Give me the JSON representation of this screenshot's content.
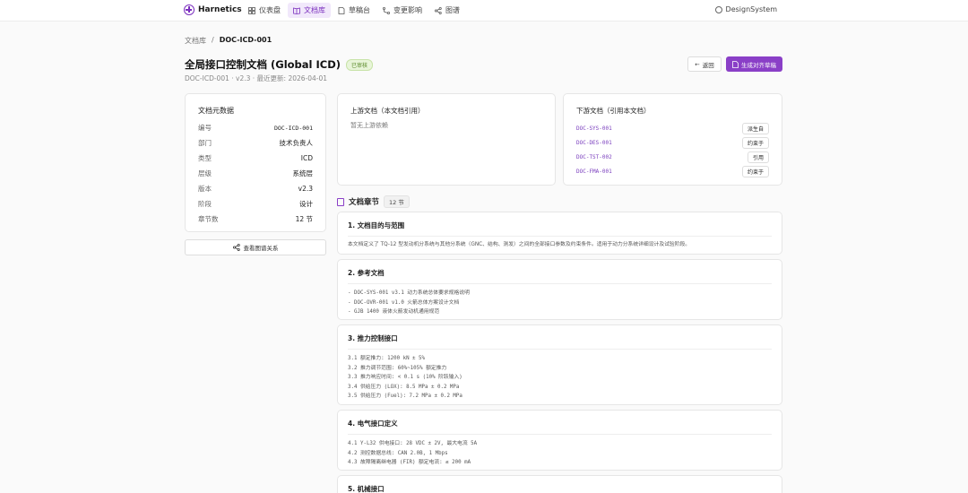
{
  "nav": {
    "brand": "Harnetics",
    "items": [
      {
        "label": "仪表盘",
        "icon": "grid-icon",
        "active": false
      },
      {
        "label": "文档库",
        "icon": "book-icon",
        "active": true
      },
      {
        "label": "草稿台",
        "icon": "draft-icon",
        "active": false
      },
      {
        "label": "变更影响",
        "icon": "impact-icon",
        "active": false
      },
      {
        "label": "图谱",
        "icon": "graph-icon",
        "active": false
      }
    ],
    "design_system": "DesignSystem"
  },
  "breadcrumb": {
    "root": "文档库",
    "separator": "/",
    "current": "DOC-ICD-001"
  },
  "header": {
    "title": "全局接口控制文档 (Global ICD)",
    "status": "已审核",
    "subtitle": "DOC-ICD-001 · v2.3 · 最近更新: 2026-04-01",
    "back_label": "返回",
    "generate_label": "生成对齐草稿"
  },
  "metadata": {
    "title": "文档元数据",
    "rows": [
      {
        "key": "编号",
        "value": "DOC-ICD-001"
      },
      {
        "key": "部门",
        "value": "技术负责人"
      },
      {
        "key": "类型",
        "value": "ICD"
      },
      {
        "key": "层级",
        "value": "系统层"
      },
      {
        "key": "版本",
        "value": "v2.3"
      },
      {
        "key": "阶段",
        "value": "设计"
      },
      {
        "key": "章节数",
        "value": "12 节"
      }
    ],
    "graph_button": "查看图谱关系"
  },
  "upstream": {
    "title": "上游文档（本文档引用）",
    "empty": "暂无上游依赖"
  },
  "downstream": {
    "title": "下游文档（引用本文档）",
    "items": [
      {
        "code": "DOC-SYS-001",
        "tag": "派生自"
      },
      {
        "code": "DOC-DES-001",
        "tag": "约束于"
      },
      {
        "code": "DOC-TST-002",
        "tag": "引用"
      },
      {
        "code": "DOC-FMA-001",
        "tag": "约束于"
      }
    ]
  },
  "sections_header": {
    "title": "文档章节",
    "count": "12 节"
  },
  "sections": [
    {
      "title": "1. 文档目的与范围",
      "lines": [
        "本文档定义了 TQ-12 型发动机分系统与其他分系统（GNC、结构、测发）之间的全部接口参数及约束条件。适用于动力分系统详细设计及试验阶段。"
      ]
    },
    {
      "title": "2. 参考文档",
      "lines": [
        "- DOC-SYS-001 v3.1 动力系统总体要求规格说明",
        "- DOC-OVR-001 v1.0 火箭总体方案设计文档",
        "- GJB 1400 液体火箭发动机通用规范"
      ]
    },
    {
      "title": "3. 推力控制接口",
      "lines": [
        "3.1 额定推力: 1200 kN ± 5%",
        "3.2 推力调节范围: 60%~105% 额定推力",
        "3.3 推力响应时间: < 0.1 s (10% 阶跃输入)",
        "3.4 供给压力 (LOX): 8.5 MPa ± 0.2 MPa",
        "3.5 供给压力 (Fuel): 7.2 MPa ± 0.2 MPa"
      ]
    },
    {
      "title": "4. 电气接口定义",
      "lines": [
        "4.1 Y-L32 供电接口: 28 VDC ± 2V, 最大电流 5A",
        "4.2 测控数据总线: CAN 2.0B, 1 Mbps",
        "4.3 故障隔离继电器 (FIR) 额定电流: ≤ 200 mA"
      ]
    },
    {
      "title": "5. 机械接口",
      "lines": []
    }
  ]
}
